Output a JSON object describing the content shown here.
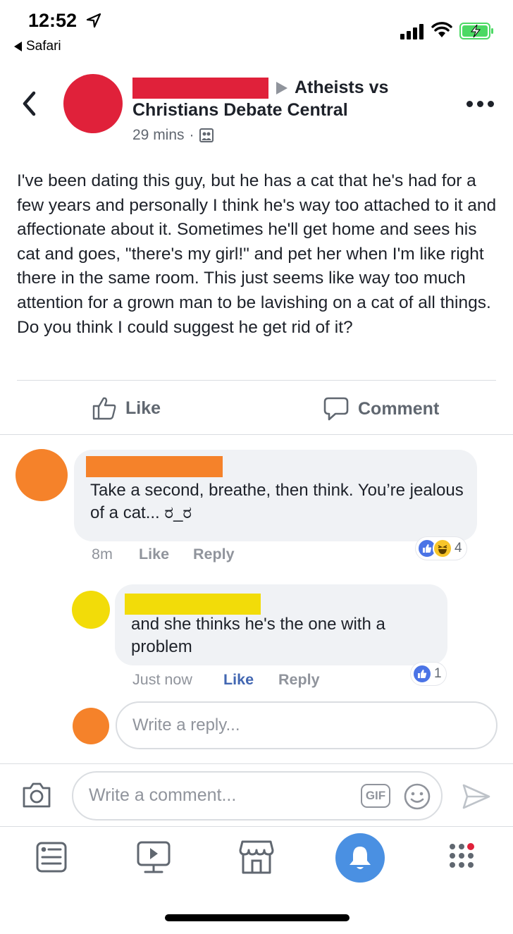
{
  "status_bar": {
    "time": "12:52",
    "back_app": "Safari"
  },
  "post": {
    "group_line1": "Atheists vs",
    "group_line2": "Christians Debate Central",
    "time": "29 mins",
    "separator": "·",
    "body": "I've been dating this guy, but he has a cat that he's had for a few years and personally I think he's way too attached to it and affectionate about it. Sometimes he'll get home and sees his cat and goes, \"there's my girl!\" and pet her when I'm like right there in the same room. This just seems like way too much attention for a grown man to be lavishing on a cat of all things. Do you think I could suggest he get rid of it?"
  },
  "actions": {
    "like": "Like",
    "comment": "Comment"
  },
  "comments": [
    {
      "text": "Take a second, breathe, then think. You’re jealous of a cat... ರ_ರ",
      "time": "8m",
      "like": "Like",
      "reply": "Reply",
      "reaction_count": "4"
    },
    {
      "text": "and she thinks he's the one with a problem",
      "time": "Just now",
      "like": "Like",
      "reply": "Reply",
      "reaction_count": "1"
    }
  ],
  "reply_input": {
    "placeholder": "Write a reply..."
  },
  "comment_input": {
    "placeholder": "Write a comment...",
    "gif_label": "GIF"
  },
  "colors": {
    "redact_red": "#e0213a",
    "redact_orange": "#f5822a",
    "redact_yellow": "#f2dc09",
    "fb_blue": "#4267b2",
    "bell_blue": "#4a90e2"
  },
  "icons": {
    "location": "location-arrow-icon",
    "signal": "signal-icon",
    "wifi": "wifi-icon",
    "battery": "battery-charging-icon",
    "back": "chevron-left-icon",
    "more": "more-icon",
    "camera": "camera-icon",
    "emoji": "emoji-icon",
    "send": "send-icon",
    "tabs": [
      "news-feed-icon",
      "watch-icon",
      "marketplace-icon",
      "notifications-icon",
      "menu-icon"
    ]
  }
}
